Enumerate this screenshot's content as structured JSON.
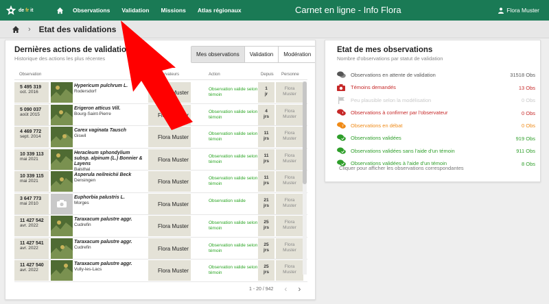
{
  "topbar": {
    "logo_text_pre": "de",
    "logo_text_fr": "fr",
    "logo_text_post": "it",
    "nav": [
      "Observations",
      "Validation",
      "Missions",
      "Atlas régionaux"
    ],
    "title": "Carnet en ligne  -  Info Flora",
    "user": "Flora Muster"
  },
  "breadcrumb": {
    "separator": "›",
    "title": "Etat des validations"
  },
  "left_card": {
    "title": "Dernières actions de validation",
    "subtitle": "Historique des actions les plus récentes",
    "tabs": [
      "Mes observations",
      "Validation",
      "Modération"
    ],
    "columns": [
      "Observation",
      "Observateurs",
      "Action",
      "Depuis",
      "Personne"
    ],
    "rows": [
      {
        "num": "5 495 319",
        "date": "oct. 2016",
        "species": "Hypericum pulchrum L.",
        "place": "Rodersdorf",
        "observer": "Flora Muster",
        "action": "Observation valide selon témoin",
        "since_n": "1",
        "since_u": "jr",
        "person1": "Flora",
        "person2": "Muster",
        "thumb": true
      },
      {
        "num": "5 090 037",
        "date": "août 2015",
        "species": "Erigeron atticus Vill.",
        "place": "Bourg-Saint-Pierre",
        "observer": "Flora Muster",
        "action": "Observation valide selon témoin",
        "since_n": "4",
        "since_u": "jrs",
        "person1": "Flora",
        "person2": "Muster",
        "thumb": true
      },
      {
        "num": "4 469 772",
        "date": "sept. 2014",
        "species": "Carex vaginata Tausch",
        "place": "Giswil",
        "observer": "Flora Muster",
        "action": "Observation valide selon témoin",
        "since_n": "11",
        "since_u": "jrs",
        "person1": "Flora",
        "person2": "Muster",
        "thumb": true
      },
      {
        "num": "10 339 113",
        "date": "mai 2021",
        "species": "Heracleum sphondylium subsp. alpinum (L.) Bonnier & Layens",
        "place": "Balsthal",
        "observer": "Flora Muster",
        "action": "Observation valide selon témoin",
        "since_n": "11",
        "since_u": "jrs",
        "person1": "Flora",
        "person2": "Muster",
        "thumb": true
      },
      {
        "num": "10 339 115",
        "date": "mai 2021",
        "species": "Asperula neilreichii Beck",
        "place": "Densingen",
        "observer": "Flora Muster",
        "action": "Observation valide selon témoin",
        "since_n": "11",
        "since_u": "jrs",
        "person1": "Flora",
        "person2": "Muster",
        "thumb": true
      },
      {
        "num": "3 647 773",
        "date": "mai 2010",
        "species": "Euphorbia palustris L.",
        "place": "Morges",
        "observer": "Flora Muster",
        "action": "Observation valide",
        "since_n": "21",
        "since_u": "jrs",
        "person1": "Flora",
        "person2": "Muster",
        "thumb": false
      },
      {
        "num": "11 427 542",
        "date": "avr. 2022",
        "species": "Taraxacum palustre aggr.",
        "place": "Cudrefin",
        "observer": "Flora Muster",
        "action": "Observation valide selon témoin",
        "since_n": "25",
        "since_u": "jrs",
        "person1": "Flora",
        "person2": "Muster",
        "thumb": true
      },
      {
        "num": "11 427 541",
        "date": "avr. 2022",
        "species": "Taraxacum palustre aggr.",
        "place": "Cudrefin",
        "observer": "Flora Muster",
        "action": "Observation valide selon témoin",
        "since_n": "25",
        "since_u": "jrs",
        "person1": "Flora",
        "person2": "Muster",
        "thumb": true
      },
      {
        "num": "11 427 540",
        "date": "avr. 2022",
        "species": "Taraxacum palustre aggr.",
        "place": "Vully-les-Lacs",
        "observer": "Flora Muster",
        "action": "Observation valide selon témoin",
        "since_n": "25",
        "since_u": "jrs",
        "person1": "Flora",
        "person2": "Muster",
        "thumb": true
      }
    ],
    "pager": "1 - 20 / 942"
  },
  "right_card": {
    "title": "Etat de mes observations",
    "subtitle": "Nombre d'observations par statut de validation",
    "stats": [
      {
        "label": "Observations en attente de validation",
        "value": "31518 Obs",
        "color": "#555555",
        "icon": "comments-icon"
      },
      {
        "label": "Témoins demandés",
        "value": "13 Obs",
        "color": "#c62828",
        "icon": "camera-icon"
      },
      {
        "label": "Peu plausible selon la modélisation",
        "value": "0 Obs",
        "color": "#c8c8c8",
        "icon": "flag-icon"
      },
      {
        "label": "Observations à confirmer par l'observateur",
        "value": "0 Obs",
        "color": "#c62828",
        "icon": "comment-alert-icon"
      },
      {
        "label": "Observations en débat",
        "value": "0 Obs",
        "color": "#ef8a17",
        "icon": "comments-debate-icon"
      },
      {
        "label": "Observations validées",
        "value": "919 Obs",
        "color": "#2e9e2a",
        "icon": "comments-check-icon"
      },
      {
        "label": "Observations validées sans l'aide d'un témoin",
        "value": "911 Obs",
        "color": "#2e9e2a",
        "icon": "comments-check-icon"
      },
      {
        "label": "Observations validées à l'aide d'un témoin",
        "value": "8 Obs",
        "color": "#2e9e2a",
        "icon": "comments-check-icon"
      }
    ],
    "footer": "Cliquer pour afficher les observations correspondantes"
  }
}
